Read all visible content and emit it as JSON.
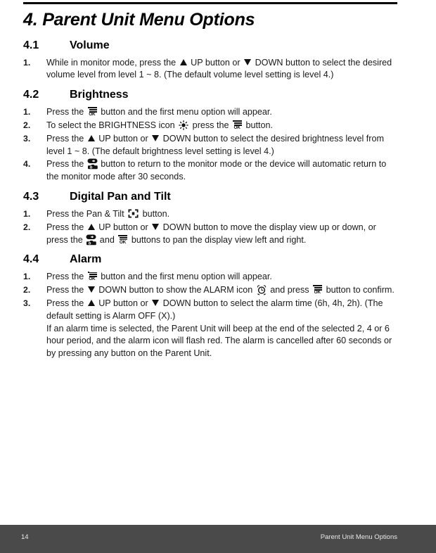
{
  "document": {
    "chapter_title": "4. Parent Unit Menu Options"
  },
  "sections": [
    {
      "number": "4.1",
      "title": "Volume",
      "steps": [
        {
          "num": "1.",
          "parts": [
            {
              "t": "text",
              "v": "While in monitor mode, press the "
            },
            {
              "t": "icon",
              "v": "up-triangle-icon"
            },
            {
              "t": "text",
              "v": " UP button or "
            },
            {
              "t": "icon",
              "v": "down-triangle-icon"
            },
            {
              "t": "text",
              "v": " DOWN button to select the desired volume level from level 1 ~ 8. (The default volume level setting is level 4.)"
            }
          ]
        }
      ]
    },
    {
      "number": "4.2",
      "title": "Brightness",
      "steps": [
        {
          "num": "1.",
          "parts": [
            {
              "t": "text",
              "v": "Press the "
            },
            {
              "t": "icon",
              "v": "ok-menu-button-icon"
            },
            {
              "t": "text",
              "v": " button and the first menu option will appear."
            }
          ]
        },
        {
          "num": "2.",
          "parts": [
            {
              "t": "text",
              "v": "To select the BRIGHTNESS icon "
            },
            {
              "t": "icon",
              "v": "brightness-sun-icon"
            },
            {
              "t": "text",
              "v": " press the "
            },
            {
              "t": "icon",
              "v": "ok-menu-button-icon"
            },
            {
              "t": "text",
              "v": " button."
            }
          ]
        },
        {
          "num": "3.",
          "parts": [
            {
              "t": "text",
              "v": "Press the "
            },
            {
              "t": "icon",
              "v": "up-triangle-icon"
            },
            {
              "t": "text",
              "v": " UP button or "
            },
            {
              "t": "icon",
              "v": "down-triangle-icon"
            },
            {
              "t": "text",
              "v": " DOWN button to select the desired brightness level from level 1 ~ 8. (The default brightness level setting is level 4.)"
            }
          ]
        },
        {
          "num": "4.",
          "parts": [
            {
              "t": "text",
              "v": "Press the "
            },
            {
              "t": "icon",
              "v": "camera-return-button-icon"
            },
            {
              "t": "text",
              "v": " button to return to the monitor mode or the device will automatic return to the monitor mode after 30 seconds."
            }
          ]
        }
      ]
    },
    {
      "number": "4.3",
      "title": "Digital Pan and Tilt",
      "steps": [
        {
          "num": "1.",
          "parts": [
            {
              "t": "text",
              "v": "Press the Pan & Tilt "
            },
            {
              "t": "icon",
              "v": "pan-tilt-frame-icon"
            },
            {
              "t": "text",
              "v": " button."
            }
          ]
        },
        {
          "num": "2.",
          "parts": [
            {
              "t": "text",
              "v": "Press the "
            },
            {
              "t": "icon",
              "v": "up-triangle-icon"
            },
            {
              "t": "text",
              "v": " UP button or "
            },
            {
              "t": "icon",
              "v": "down-triangle-icon"
            },
            {
              "t": "text",
              "v": " DOWN button to move the display view up or down, or press the "
            },
            {
              "t": "icon",
              "v": "camera-return-button-icon"
            },
            {
              "t": "text",
              "v": " and "
            },
            {
              "t": "icon",
              "v": "ok-menu-button-icon"
            },
            {
              "t": "text",
              "v": " buttons to pan the display view left and right."
            }
          ]
        }
      ]
    },
    {
      "number": "4.4",
      "title": "Alarm",
      "steps": [
        {
          "num": "1.",
          "parts": [
            {
              "t": "text",
              "v": "Press the "
            },
            {
              "t": "icon",
              "v": "ok-menu-button-icon"
            },
            {
              "t": "text",
              "v": " button and the first menu option will appear."
            }
          ]
        },
        {
          "num": "2.",
          "parts": [
            {
              "t": "text",
              "v": "Press the "
            },
            {
              "t": "icon",
              "v": "down-triangle-icon"
            },
            {
              "t": "text",
              "v": " DOWN button to show the ALARM icon "
            },
            {
              "t": "icon",
              "v": "alarm-clock-icon"
            },
            {
              "t": "text",
              "v": " and press "
            },
            {
              "t": "icon",
              "v": "ok-menu-button-icon"
            },
            {
              "t": "text",
              "v": " button to confirm."
            }
          ]
        },
        {
          "num": "3.",
          "parts": [
            {
              "t": "text",
              "v": "Press the "
            },
            {
              "t": "icon",
              "v": "up-triangle-icon"
            },
            {
              "t": "text",
              "v": " UP button or "
            },
            {
              "t": "icon",
              "v": "down-triangle-icon"
            },
            {
              "t": "text",
              "v": " DOWN button to select the alarm time (6h, 4h, 2h). (The default setting is Alarm OFF (X).)"
            },
            {
              "t": "break"
            },
            {
              "t": "text",
              "v": "If an alarm time is selected, the Parent Unit will beep at the end of the selected 2, 4 or 6 hour period, and the alarm icon will flash red. The alarm is cancelled after 60 seconds or by pressing any button on the Parent Unit."
            }
          ]
        }
      ]
    }
  ],
  "footer": {
    "page_number": "14",
    "running_title": "Parent Unit Menu Options",
    "background_color": "#4a4a4a",
    "text_color": "#e8e8e8"
  }
}
